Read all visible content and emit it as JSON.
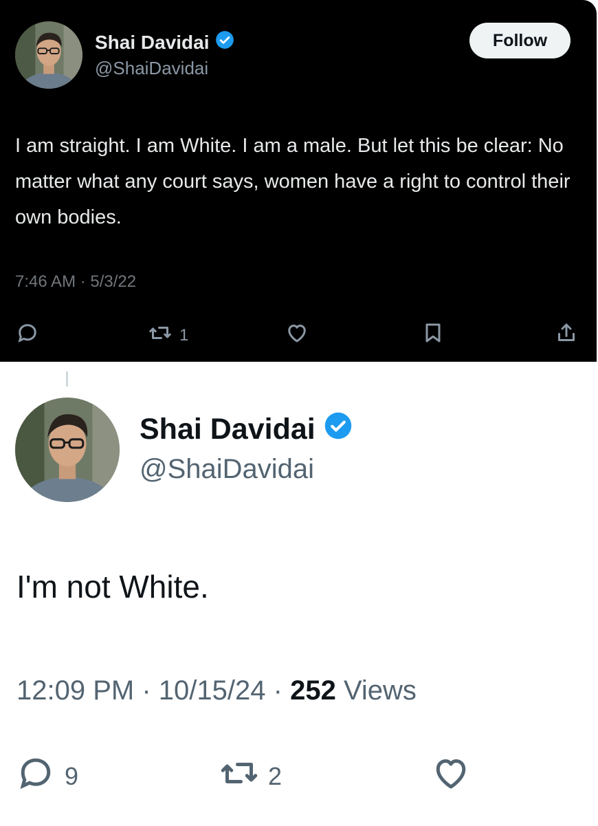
{
  "colors": {
    "dark_bg": "#000000",
    "verified_blue": "#1d9bf0",
    "light_bg": "#ffffff"
  },
  "top_tweet": {
    "author_name": "Shai Davidai",
    "handle": "@ShaiDavidai",
    "verified_icon": "verified-badge-icon",
    "follow_label": "Follow",
    "text": "I am straight. I am White. I am a male. But let this be clear: No matter what any court says, women have a right to control their own bodies.",
    "timestamp": "7:46 AM · 5/3/22",
    "actions": {
      "reply_icon": "reply-icon",
      "retweet_icon": "retweet-icon",
      "retweet_count": "1",
      "like_icon": "heart-icon",
      "bookmark_icon": "bookmark-icon",
      "share_icon": "share-icon"
    }
  },
  "bottom_tweet": {
    "author_name": "Shai Davidai",
    "handle": "@ShaiDavidai",
    "verified_icon": "verified-badge-icon",
    "text": "I'm not White.",
    "time": "12:09 PM",
    "date": "10/15/24",
    "separator": "·",
    "views_count": "252",
    "views_label": "Views",
    "actions": {
      "reply_icon": "reply-icon",
      "reply_count": "9",
      "retweet_icon": "retweet-icon",
      "retweet_count": "2",
      "like_icon": "heart-icon"
    }
  }
}
